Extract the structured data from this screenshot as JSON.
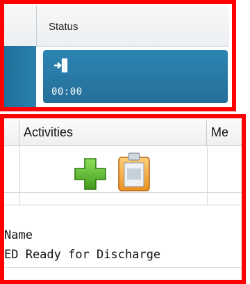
{
  "status_panel": {
    "header": "Status",
    "tile": {
      "icon": "enter-door-icon",
      "timer": "00:00"
    }
  },
  "activities_panel": {
    "headers": [
      "Activities",
      "Me"
    ],
    "row_icons": [
      "add-plus-icon",
      "clipboard-icon"
    ],
    "name_label": "Name",
    "name_value": "ED Ready for Discharge"
  },
  "colors": {
    "highlight_border": "#ff0000",
    "status_tile": "#2a7fad",
    "plus_green": "#5fbf2a",
    "clipboard_orange": "#f2a33a"
  }
}
